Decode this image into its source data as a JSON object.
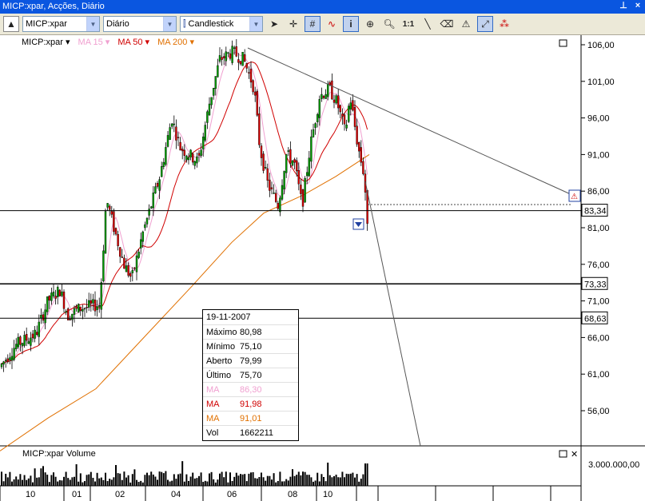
{
  "window": {
    "title": "MICP:xpar, Acções, Diário"
  },
  "toolbar": {
    "symbol": "MICP:xpar",
    "period": "Diário",
    "chart_type": "Candlestick",
    "zoom_label": "1:1"
  },
  "legend": {
    "symbol": "MICP:xpar",
    "ma15": "MA 15",
    "ma50": "MA 50",
    "ma200": "MA 200"
  },
  "price_markers": {
    "m1": "83,34",
    "m2": "73,33",
    "m3": "68,63"
  },
  "volume_panel": {
    "title": "MICP:xpar Volume",
    "axis_label": "3.000.000,00"
  },
  "tooltip": {
    "date": "19-11-2007",
    "rows": [
      {
        "label": "Máximo",
        "value": "80,98",
        "color": "#000000"
      },
      {
        "label": "Mínimo",
        "value": "75,10",
        "color": "#000000"
      },
      {
        "label": "Aberto",
        "value": "79,99",
        "color": "#000000"
      },
      {
        "label": "Último",
        "value": "75,70",
        "color": "#000000"
      },
      {
        "label": "MA",
        "value": "86,30",
        "color": "#f0a0d0"
      },
      {
        "label": "MA",
        "value": "91,98",
        "color": "#d00000"
      },
      {
        "label": "MA",
        "value": "91,01",
        "color": "#e07000"
      },
      {
        "label": "Vol",
        "value": "1662211",
        "color": "#000000"
      }
    ]
  },
  "chart_data": {
    "type": "candlestick",
    "y_ticks": [
      "106,00",
      "101,00",
      "96,00",
      "91,00",
      "86,00",
      "81,00",
      "76,00",
      "71,00",
      "66,00",
      "61,00",
      "56,00"
    ],
    "x_ticks": [
      "10",
      "01",
      "02",
      "04",
      "06",
      "08",
      "10"
    ],
    "ylim": [
      50,
      108
    ],
    "horizontal_lines": [
      83.34,
      73.33,
      68.63
    ],
    "colors": {
      "up": "#00a000",
      "down": "#e00000",
      "ma15": "#f0a0d0",
      "ma50": "#d00000",
      "ma200": "#e07000"
    }
  }
}
